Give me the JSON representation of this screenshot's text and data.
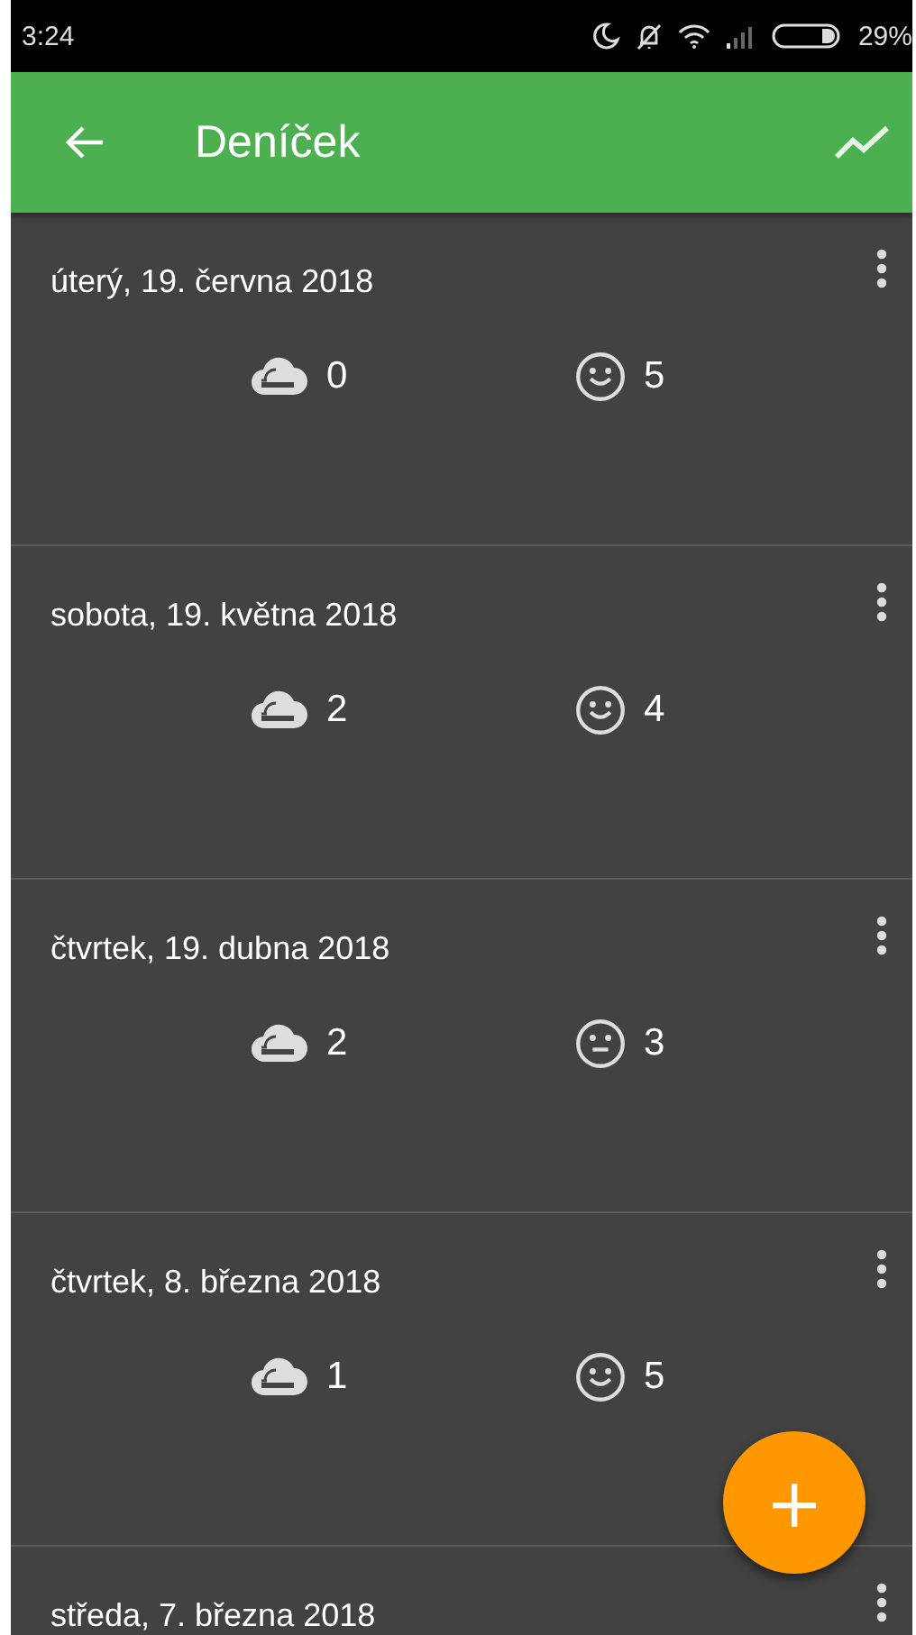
{
  "status_bar": {
    "time": "3:24",
    "battery": "29%"
  },
  "app_bar": {
    "title": "Deníček"
  },
  "entries": [
    {
      "date": "úterý, 19. června 2018",
      "smoking": "0",
      "mood": {
        "kind": "happy",
        "value": "5"
      }
    },
    {
      "date": "sobota, 19. května 2018",
      "smoking": "2",
      "mood": {
        "kind": "happy",
        "value": "4"
      }
    },
    {
      "date": "čtvrtek, 19. dubna 2018",
      "smoking": "2",
      "mood": {
        "kind": "neutral",
        "value": "3"
      }
    },
    {
      "date": "čtvrtek, 8. března 2018",
      "smoking": "1",
      "mood": {
        "kind": "happy",
        "value": "5"
      }
    },
    {
      "date": "středa, 7. března 2018"
    }
  ],
  "fab": {
    "label": "+"
  }
}
